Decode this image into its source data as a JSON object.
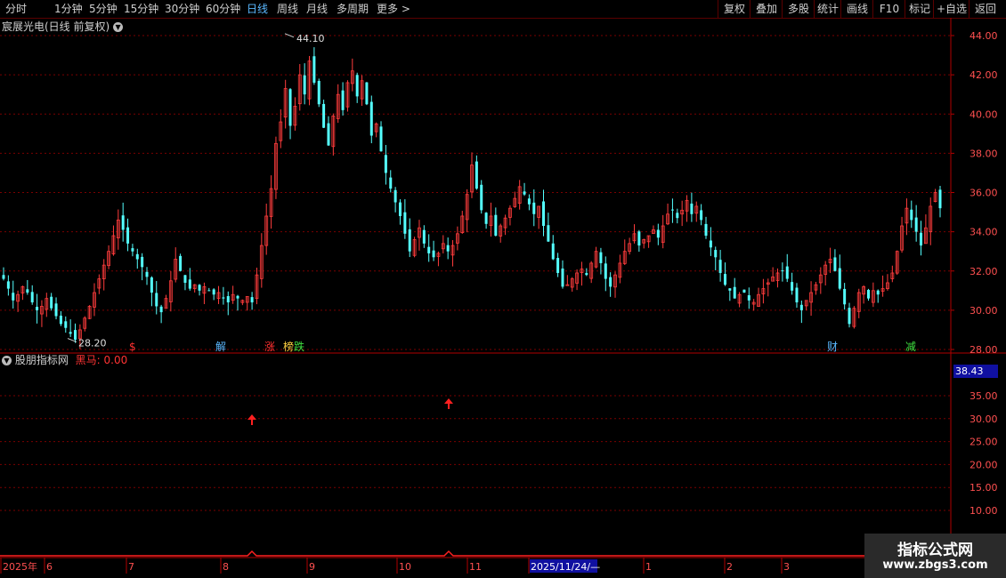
{
  "toolbar": {
    "periods": [
      "分时",
      "1分钟",
      "5分钟",
      "15分钟",
      "30分钟",
      "60分钟",
      "日线",
      "周线",
      "月线",
      "多周期",
      "更多 >"
    ],
    "active_period": "日线",
    "right_buttons": [
      "复权",
      "叠加",
      "多股",
      "统计",
      "画线",
      "F10",
      "标记",
      "+自选",
      "返回"
    ]
  },
  "main_header": {
    "title": "宸展光电(日线 前复权)"
  },
  "indicator": {
    "name": "股朋指标网",
    "series_label": "黑马: 0.00",
    "current_value": "38.43"
  },
  "price_axis": {
    "labels": [
      "44.00",
      "42.00",
      "40.00",
      "38.00",
      "36.00",
      "34.00",
      "32.00",
      "30.00",
      "28.00"
    ]
  },
  "indicator_axis": {
    "labels": [
      "35.00",
      "30.00",
      "25.00",
      "20.00",
      "15.00",
      "10.00"
    ]
  },
  "date_axis": {
    "labels": [
      "2025年",
      "6",
      "7",
      "8",
      "9",
      "10",
      "11",
      "2025/11/24/—",
      "1",
      "2",
      "3"
    ]
  },
  "annotations": {
    "high": "44.10",
    "low": "28.20"
  },
  "event_markers": [
    {
      "label": "$",
      "color": "#ff3030"
    },
    {
      "label": "解",
      "color": "#5ab8ff"
    },
    {
      "label": "涨",
      "color": "#ff3030"
    },
    {
      "label": "榜",
      "color": "#ffd040"
    },
    {
      "label": "跌",
      "color": "#40e040"
    },
    {
      "label": "财",
      "color": "#5ab8ff"
    },
    {
      "label": "减",
      "color": "#40e040"
    }
  ],
  "colors": {
    "up": "#ff3c3c",
    "down": "#54ffff",
    "grid": "#7a0000",
    "axis": "#b00000",
    "indicator": "#ff2020"
  },
  "watermark": {
    "line1": "指标公式网",
    "line2": "www.zbgs3.com"
  },
  "chart_data": {
    "type": "candlestick",
    "ylim": [
      27.5,
      44.8
    ],
    "closes": [
      31.6,
      31.1,
      30.5,
      30.8,
      31.2,
      30.9,
      30.4,
      30.0,
      30.2,
      30.6,
      30.1,
      29.7,
      29.3,
      29.1,
      28.8,
      28.5,
      29.0,
      29.6,
      30.2,
      30.9,
      31.6,
      32.3,
      33.0,
      33.8,
      34.6,
      34.1,
      33.4,
      33.0,
      32.6,
      32.2,
      31.7,
      30.9,
      30.2,
      29.9,
      30.6,
      31.5,
      32.6,
      32.0,
      31.4,
      31.1,
      31.3,
      31.0,
      31.2,
      31.0,
      30.8,
      30.9,
      30.6,
      30.4,
      30.8,
      30.6,
      30.5,
      30.7,
      30.4,
      31.8,
      33.3,
      34.8,
      36.2,
      38.5,
      39.6,
      41.3,
      39.4,
      40.4,
      42.0,
      41.0,
      42.7,
      41.6,
      40.5,
      39.3,
      38.4,
      39.9,
      41.0,
      40.2,
      41.6,
      42.2,
      40.9,
      41.7,
      40.5,
      38.9,
      39.5,
      38.1,
      37.0,
      36.2,
      35.5,
      34.8,
      33.9,
      33.0,
      33.6,
      34.2,
      33.4,
      32.9,
      32.7,
      32.9,
      33.4,
      33.0,
      33.3,
      33.9,
      34.8,
      35.9,
      37.4,
      36.2,
      35.1,
      34.4,
      34.8,
      33.8,
      34.3,
      34.7,
      35.2,
      35.7,
      36.3,
      35.9,
      35.4,
      34.9,
      35.3,
      34.3,
      33.5,
      32.6,
      31.9,
      31.2,
      31.3,
      31.6,
      31.9,
      32.1,
      31.8,
      32.4,
      33.0,
      32.4,
      31.6,
      31.2,
      31.8,
      32.4,
      33.0,
      33.4,
      33.9,
      33.3,
      33.6,
      33.8,
      34.1,
      33.7,
      34.3,
      34.9,
      35.1,
      34.7,
      35.1,
      35.6,
      34.9,
      35.3,
      34.6,
      33.8,
      33.2,
      32.7,
      31.9,
      31.3,
      31.0,
      30.6,
      30.8,
      30.9,
      30.5,
      30.4,
      30.8,
      31.1,
      31.4,
      31.7,
      31.9,
      32.0,
      31.6,
      31.0,
      30.4,
      30.0,
      30.5,
      30.9,
      31.3,
      31.8,
      32.3,
      32.6,
      32.0,
      31.1,
      30.3,
      29.3,
      30.1,
      30.9,
      31.2,
      30.6,
      31.0,
      30.8,
      31.1,
      31.4,
      31.9,
      33.0,
      34.3,
      35.2,
      34.6,
      34.0,
      33.3,
      34.2,
      35.3,
      36.0,
      35.2
    ]
  }
}
